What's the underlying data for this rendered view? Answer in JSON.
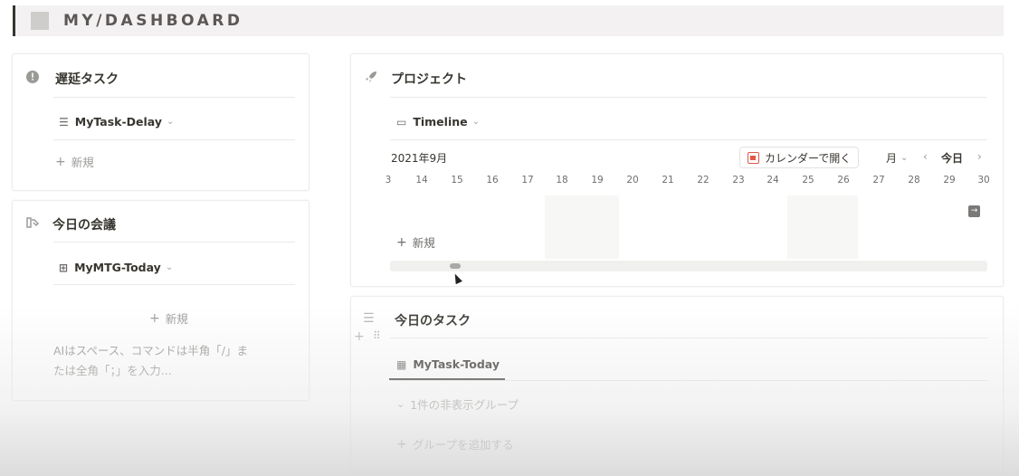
{
  "header": {
    "title": "MY/DASHBOARD"
  },
  "delay_card": {
    "title": "遅延タスク",
    "view": "MyTask-Delay",
    "new_label": "新規"
  },
  "meeting_card": {
    "title": "今日の会議",
    "view": "MyMTG-Today",
    "new_label": "新規",
    "hint_line1": "AIはスペース、コマンドは半角「/」ま",
    "hint_line2": "たは全角「；」を入力..."
  },
  "project_card": {
    "title": "プロジェクト",
    "view": "Timeline",
    "month_label": "2021年9月",
    "open_calendar_label": "カレンダーで開く",
    "scale_label": "月",
    "today_label": "今日",
    "days": [
      "3",
      "14",
      "15",
      "16",
      "17",
      "18",
      "19",
      "20",
      "21",
      "22",
      "23",
      "24",
      "25",
      "26",
      "27",
      "28",
      "29",
      "30"
    ],
    "new_label": "新規"
  },
  "today_task_card": {
    "title": "今日のタスク",
    "view": "MyTask-Today",
    "hidden_group_label": "1件の非表示グループ",
    "add_group_label": "グループを追加する"
  },
  "icons": {
    "delay": "clock-alert-icon",
    "meeting": "handshake-icon",
    "project": "rocket-icon",
    "today_task": "checklist-icon"
  }
}
